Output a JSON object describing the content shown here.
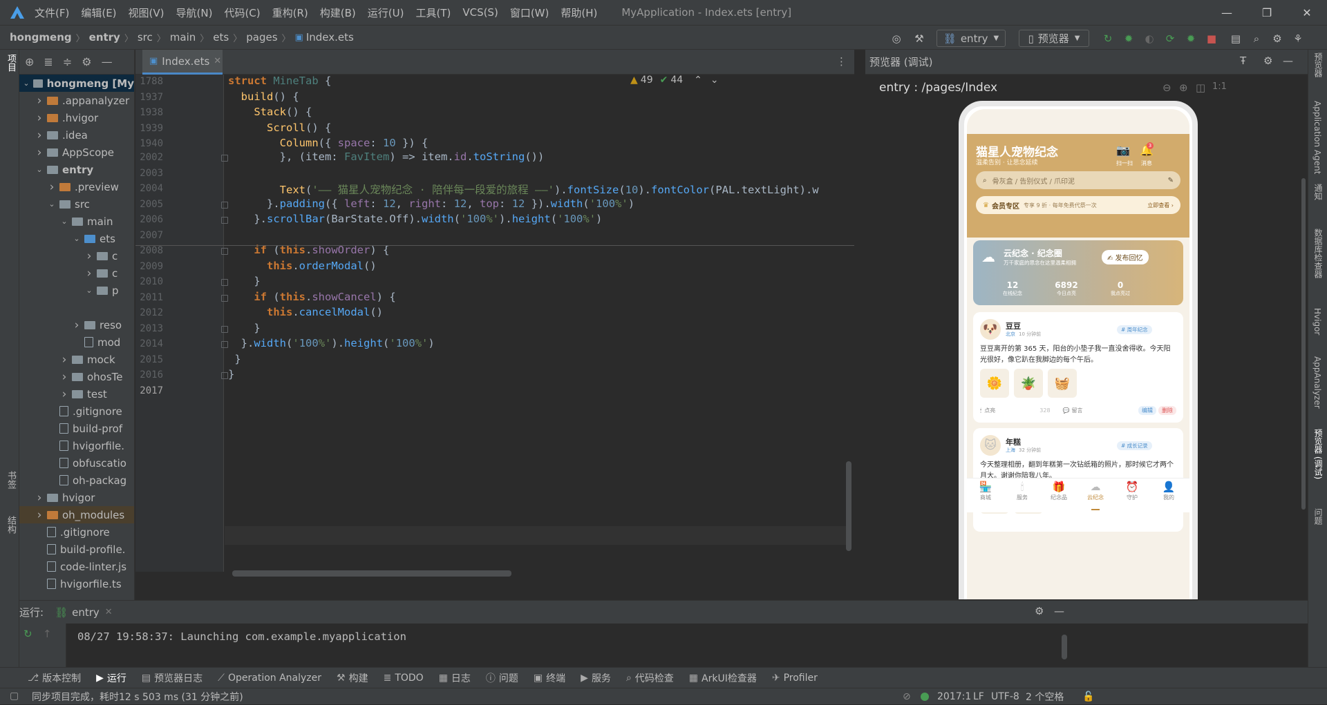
{
  "window": {
    "title": "MyApplication - Index.ets [entry]"
  },
  "menu": [
    "文件(F)",
    "编辑(E)",
    "视图(V)",
    "导航(N)",
    "代码(C)",
    "重构(R)",
    "构建(B)",
    "运行(U)",
    "工具(T)",
    "VCS(S)",
    "窗口(W)",
    "帮助(H)"
  ],
  "breadcrumb": [
    "hongmeng",
    "entry",
    "src",
    "main",
    "ets",
    "pages",
    "Index.ets"
  ],
  "toolbar": {
    "module": "entry",
    "previewer": "预览器"
  },
  "left_strip": {
    "project": "项目",
    "bookmarks": "书签",
    "structure": "结构"
  },
  "project_tree": [
    {
      "label": "hongmeng [My",
      "depth": 0,
      "open": true,
      "kind": "folder",
      "sel": true
    },
    {
      "label": ".appanalyzer",
      "depth": 1,
      "open": false,
      "kind": "folder-or"
    },
    {
      "label": ".hvigor",
      "depth": 1,
      "open": false,
      "kind": "folder-or"
    },
    {
      "label": ".idea",
      "depth": 1,
      "open": false,
      "kind": "folder"
    },
    {
      "label": "AppScope",
      "depth": 1,
      "open": false,
      "kind": "folder"
    },
    {
      "label": "entry",
      "depth": 1,
      "open": true,
      "kind": "folder",
      "bold": true
    },
    {
      "label": ".preview",
      "depth": 2,
      "open": false,
      "kind": "folder-or"
    },
    {
      "label": "src",
      "depth": 2,
      "open": true,
      "kind": "folder"
    },
    {
      "label": "main",
      "depth": 3,
      "open": true,
      "kind": "folder"
    },
    {
      "label": "ets",
      "depth": 4,
      "open": true,
      "kind": "folder-bl"
    },
    {
      "label": "c",
      "depth": 5,
      "open": false,
      "kind": "folder"
    },
    {
      "label": "c",
      "depth": 5,
      "open": false,
      "kind": "folder"
    },
    {
      "label": "p",
      "depth": 5,
      "open": true,
      "kind": "folder"
    },
    {
      "label": "",
      "depth": 5,
      "open": null,
      "kind": "none"
    },
    {
      "label": "reso",
      "depth": 4,
      "open": false,
      "kind": "folder"
    },
    {
      "label": "mod",
      "depth": 4,
      "open": null,
      "kind": "file"
    },
    {
      "label": "mock",
      "depth": 3,
      "open": false,
      "kind": "folder"
    },
    {
      "label": "ohosTe",
      "depth": 3,
      "open": false,
      "kind": "folder"
    },
    {
      "label": "test",
      "depth": 3,
      "open": false,
      "kind": "folder"
    },
    {
      "label": ".gitignore",
      "depth": 2,
      "open": null,
      "kind": "file"
    },
    {
      "label": "build-prof",
      "depth": 2,
      "open": null,
      "kind": "file"
    },
    {
      "label": "hvigorfile.",
      "depth": 2,
      "open": null,
      "kind": "file"
    },
    {
      "label": "obfuscatio",
      "depth": 2,
      "open": null,
      "kind": "file"
    },
    {
      "label": "oh-packag",
      "depth": 2,
      "open": null,
      "kind": "file"
    },
    {
      "label": "hvigor",
      "depth": 1,
      "open": false,
      "kind": "folder"
    },
    {
      "label": "oh_modules",
      "depth": 1,
      "open": false,
      "kind": "folder-or",
      "orange": true
    },
    {
      "label": ".gitignore",
      "depth": 1,
      "open": null,
      "kind": "file"
    },
    {
      "label": "build-profile.",
      "depth": 1,
      "open": null,
      "kind": "file"
    },
    {
      "label": "code-linter.js",
      "depth": 1,
      "open": null,
      "kind": "file"
    },
    {
      "label": "hvigorfile.ts",
      "depth": 1,
      "open": null,
      "kind": "file"
    }
  ],
  "editor": {
    "tab": "Index.ets",
    "warnings": "49",
    "weak_warnings": "44",
    "sticky": [
      {
        "n": "1788",
        "indent": 0,
        "html": "struct MineTab {"
      },
      {
        "n": "1937",
        "indent": 1,
        "html": "build() {"
      },
      {
        "n": "1938",
        "indent": 2,
        "html": "Stack() {"
      },
      {
        "n": "1939",
        "indent": 3,
        "html": "Scroll() {"
      },
      {
        "n": "1940",
        "indent": 4,
        "html": "Column({ space: 10 }) {"
      }
    ],
    "lines": [
      {
        "n": "2002",
        "text": "        }, (item: FavItem) => item.id.toString())"
      },
      {
        "n": "2003",
        "text": ""
      },
      {
        "n": "2004",
        "text": "        Text('—— 猫星人宠物纪念 · 陪伴每一段爱的旅程 ——').fontSize(10).fontColor(PAL.textLight).w"
      },
      {
        "n": "2005",
        "text": "      }.padding({ left: 12, right: 12, top: 12 }).width('100%')"
      },
      {
        "n": "2006",
        "text": "    }.scrollBar(BarState.Off).width('100%').height('100%')"
      },
      {
        "n": "2007",
        "text": ""
      },
      {
        "n": "2008",
        "text": "    if (this.showOrder) {"
      },
      {
        "n": "2009",
        "text": "      this.orderModal()"
      },
      {
        "n": "2010",
        "text": "    }"
      },
      {
        "n": "2011",
        "text": "    if (this.showCancel) {"
      },
      {
        "n": "2012",
        "text": "      this.cancelModal()"
      },
      {
        "n": "2013",
        "text": "    }"
      },
      {
        "n": "2014",
        "text": "  }.width('100%').height('100%')"
      },
      {
        "n": "2015",
        "text": " }"
      },
      {
        "n": "2016",
        "text": "}"
      },
      {
        "n": "2017",
        "text": ""
      }
    ]
  },
  "preview": {
    "panel_title": "预览器 (调试)",
    "path": "entry : /pages/Index",
    "app": {
      "title": "猫星人宠物纪念",
      "subtitle": "温柔告别 · 让思念延续",
      "scan": "扫一扫",
      "message": "消息",
      "badge": "3",
      "search_placeholder": "骨灰盒 / 告别仪式 / 爪印泥",
      "vip_label": "会员专区",
      "vip_text": "专享 9 折 · 每年免费代祭一次",
      "vip_link": "立即查看 ›",
      "cloud_title": "云纪念 · 纪念圈",
      "cloud_sub": "万千家庭的思念在这里温柔相拥",
      "cloud_btn": "✍ 发布回忆",
      "stats": [
        {
          "v": "12",
          "l": "在线纪念"
        },
        {
          "v": "6892",
          "l": "今日点亮"
        },
        {
          "v": "0",
          "l": "我点亮过"
        }
      ],
      "posts": [
        {
          "avatar": "🐶",
          "name": "豆豆",
          "loc": "北京",
          "time": "10 分钟前",
          "tag": "# 周年纪念",
          "text": "豆豆离开的第 365 天，阳台的小垫子我一直没舍得收。今天阳光很好，像它趴在我脚边的每个午后。",
          "thumbs": [
            "🌼",
            "🪴",
            "🧺"
          ],
          "light": "点亮",
          "count": "328",
          "comment": "留言",
          "edit": "编辑",
          "del": "删除"
        },
        {
          "avatar": "🐱",
          "name": "年糕",
          "loc": "上海",
          "time": "32 分钟前",
          "tag": "# 成长记录",
          "text": "今天整理相册，翻到年糕第一次钻纸箱的照片，那时候它才两个月大。谢谢你陪我八年。",
          "thumbs": [
            "📦",
            "📷"
          ]
        }
      ],
      "nav": [
        {
          "icon": "🏪",
          "label": "商城"
        },
        {
          "icon": "🕯",
          "label": "服务"
        },
        {
          "icon": "🎁",
          "label": "纪念品"
        },
        {
          "icon": "☁",
          "label": "云纪念",
          "active": true
        },
        {
          "icon": "⏰",
          "label": "守护"
        },
        {
          "icon": "👤",
          "label": "我的"
        }
      ]
    }
  },
  "right_strip": [
    "预览器",
    "Application Agent",
    "通知",
    "数据库检查器",
    "Hvigor",
    "AppAnalyzer",
    "预览器 (调试)",
    "问题"
  ],
  "run": {
    "label": "运行:",
    "tab": "entry",
    "log": "08/27 19:58:37: Launching com.example.myapplication"
  },
  "tooltabs": [
    "版本控制",
    "运行",
    "预览器日志",
    "Operation Analyzer",
    "构建",
    "TODO",
    "日志",
    "问题",
    "终端",
    "服务",
    "代码检查",
    "ArkUI检查器",
    "Profiler"
  ],
  "status": {
    "message": "同步项目完成，耗时12 s 503 ms (31 分钟之前)",
    "pos": "2017:1",
    "lf": "LF",
    "enc": "UTF-8",
    "indent": "2 个空格"
  },
  "colors": {
    "accent": "#4a88c7",
    "warn": "#be9117",
    "ok": "#499c54",
    "stop": "#c75450",
    "brand": "#d2ab6c"
  }
}
